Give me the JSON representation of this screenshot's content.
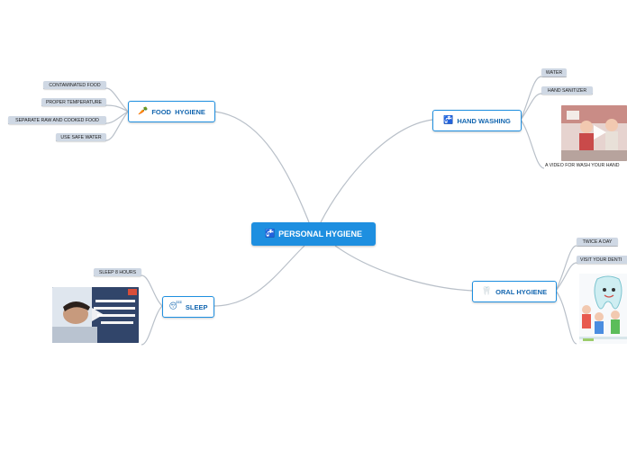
{
  "root": {
    "label": "PERSONAL HYGIENE",
    "icon": "sink-icon"
  },
  "topics": {
    "food": {
      "label": "FOOD  HYGIENE",
      "icon": "carrot-icon",
      "items": [
        "CONTAMINATED FOOD",
        "PROPER TEMPERATURE",
        "SEPARATE RAW AND COOKED FOOD",
        "USE SAFE WATER"
      ]
    },
    "hand": {
      "label": "HAND WASHING",
      "icon": "faucet-icon",
      "items": [
        "WATER",
        "HAND SANITIZER"
      ],
      "video_caption": "A VIDEO FOR WASH YOUR HAND"
    },
    "sleep": {
      "label": "SLEEP",
      "icon": "sleeping-face-icon",
      "items": [
        "SLEEP 8 HOURS"
      ]
    },
    "oral": {
      "label": "ORAL HYGIENE",
      "icon": "tooth-icon",
      "items": [
        "TWICE A DAY",
        "VISIT YOUR DENTI"
      ]
    }
  },
  "colors": {
    "accent": "#1e8fe0",
    "link": "#b9c0c9",
    "sub_bg": "#cfd8e4"
  }
}
